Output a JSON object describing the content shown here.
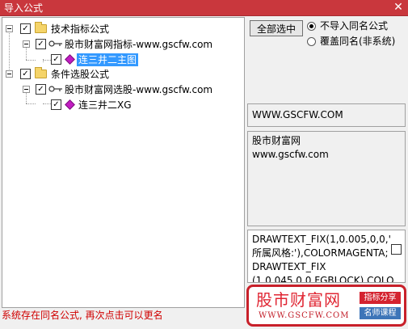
{
  "window": {
    "title": "导入公式",
    "close_glyph": "✕"
  },
  "tree": {
    "nodes": [
      {
        "label": "技术指标公式",
        "checked": true,
        "icon": "folder-icon"
      },
      {
        "label": "股市财富网指标-www.gscfw.com",
        "checked": true,
        "icon": "key-icon"
      },
      {
        "label": "连三井二主图",
        "checked": true,
        "icon": "diamond-icon",
        "selected": true
      },
      {
        "label": "条件选股公式",
        "checked": true,
        "icon": "folder-icon"
      },
      {
        "label": "股市财富网选股-www.gscfw.com",
        "checked": true,
        "icon": "key-icon"
      },
      {
        "label": "连三井二XG",
        "checked": true,
        "icon": "diamond-icon"
      }
    ],
    "check_glyph": "✓"
  },
  "options": {
    "select_all_label": "全部选中",
    "radio_skip_label": "不导入同名公式",
    "radio_overwrite_label": "覆盖同名(非系统)",
    "selected_option": "skip"
  },
  "info": {
    "source": "WWW.GSCFW.COM",
    "description_line1": "股市财富网",
    "description_line2": "www.gscfw.com",
    "code_line1": "DRAWTEXT_FIX(1,0.005,0,0,'",
    "code_line2": "所属风格:'),COLORMAGENTA;",
    "code_line3": "DRAWTEXT_FIX",
    "code_line4": "(1,0.045,0,0,FGBLOCK),COLO"
  },
  "status": {
    "message": "系统存在同名公式, 再次点击可以更名"
  },
  "watermark": {
    "brand": "股市财富网",
    "url": "WWW.GSCFW.COM",
    "tag1": "指标分享",
    "tag2": "名师课程"
  },
  "colors": {
    "titlebar": "#c9373d",
    "status_text": "#d00000",
    "selection": "#3399ff",
    "diamond": "#c21cc2"
  }
}
